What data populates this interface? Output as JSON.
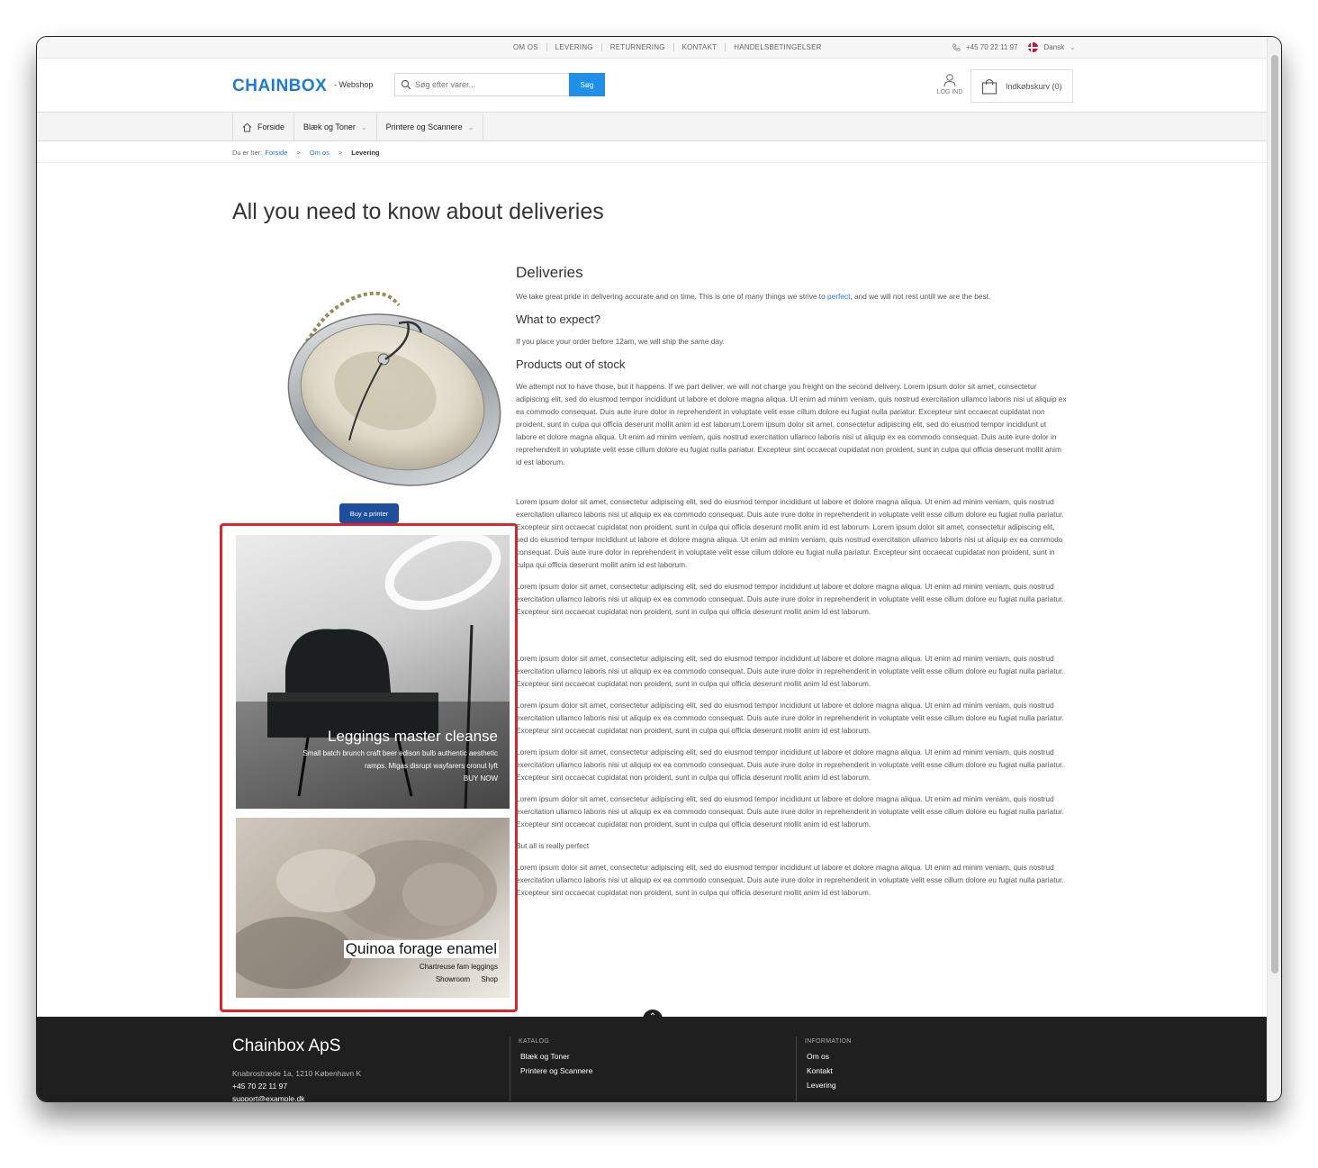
{
  "topbar": {
    "links": [
      "OM OS",
      "LEVERING",
      "RETURNERING",
      "KONTAKT",
      "HANDELSBETINGELSER"
    ],
    "phone": "+45 70 22 11 97",
    "language": "Dansk"
  },
  "header": {
    "logo": "CHAINBOX",
    "logo_sub": "- Webshop",
    "search_placeholder": "Søg efter varer...",
    "search_button": "Søg",
    "login_label": "LOG IND",
    "cart_label": "Indkøbskurv (0)"
  },
  "nav": {
    "items": [
      {
        "label": "Forside"
      },
      {
        "label": "Blæk og Toner"
      },
      {
        "label": "Printere og Scannere"
      }
    ]
  },
  "breadcrumb": {
    "prefix": "Du er her:",
    "items": [
      "Forside",
      "Om os",
      "Levering"
    ],
    "separator": ">"
  },
  "page": {
    "title": "All you need to know about deliveries",
    "buy_printer_button": "Buy a printer"
  },
  "promos": [
    {
      "title": "Leggings master cleanse",
      "subtitle_line1": "Small batch brunch craft beer edison bulb authentic aesthetic",
      "subtitle_line2": "ramps. Migas disrupt wayfarers cronut lyft",
      "cta": "BUY NOW"
    },
    {
      "title": "Quinoa forage enamel",
      "subtitle_line1": "Chartreuse fam leggings",
      "links": [
        "Showroom",
        "Shop"
      ]
    }
  ],
  "content": {
    "deliveries_heading": "Deliveries",
    "deliveries_text_pre": "We take great pride in delivering accurate and on time. This is one of many things we strive to",
    "deliveries_link": "perfect",
    "deliveries_text_post": ", and we will not rest untill we are the best.",
    "expect_heading": "What to expect?",
    "expect_text": "If you place your order before 12am, we will ship the same day.",
    "stock_heading": "Products out of stock",
    "stock_text": "We attempt not to have those, but it happens. If we part deliver, we will not charge you freight on the second delivery. Lorem ipsum dolor sit amet, consectetur adipiscing elit, sed do eiusmod tempor incididunt ut labore et dolore magna aliqua. Ut enim ad minim veniam, quis nostrud exercitation ullamco laboris nisi ut aliquip ex ea commodo consequat. Duis aute irure dolor in reprehenderit in voluptate velit esse cillum dolore eu fugiat nulla pariatur. Excepteur sint occaecat cupidatat non proident, sunt in culpa qui officia deserunt mollit anim id est laborum.Lorem ipsum dolor sit amet, consectetur adipiscing elit, sed do eiusmod tempor incididunt ut labore et dolore magna aliqua. Ut enim ad minim veniam, quis nostrud exercitation ullamco laboris nisi ut aliquip ex ea commodo consequat. Duis aute irure dolor in reprehenderit in voluptate velit esse cillum dolore eu fugiat nulla pariatur. Excepteur sint occaecat cupidatat non proident, sunt in culpa qui officia deserunt mollit anim id est laborum.",
    "para_long": "Lorem ipsum dolor sit amet, consectetur adipiscing elit, sed do eiusmod tempor incididunt ut labore et dolore magna aliqua. Ut enim ad minim veniam, quis nostrud exercitation ullamco laboris nisi ut aliquip ex ea commodo consequat. Duis aute irure dolor in reprehenderit in voluptate velit esse cillum dolore eu fugiat nulla pariatur. Excepteur sint occaecat cupidatat non proident, sunt in culpa qui officia deserunt mollit anim id est laborum. Lorem ipsum dolor sit amet, consectetur adipiscing elit, sed do eiusmod tempor incididunt ut labore et dolore magna aliqua. Ut enim ad minim veniam, quis nostrud exercitation ullamco laboris nisi ut aliquip ex ea commodo consequat. Duis aute irure dolor in reprehenderit in voluptate velit esse cillum dolore eu fugiat nulla pariatur. Excepteur sint occaecat cupidatat non proident, sunt in culpa qui officia deserunt mollit anim id est laborum.",
    "para_short": "Lorem ipsum dolor sit amet, consectetur adipiscing elit, sed do eiusmod tempor incididunt ut labore et dolore magna aliqua. Ut enim ad minim veniam, quis nostrud exercitation ullamco laboris nisi ut aliquip ex ea commodo consequat. Duis aute irure dolor in reprehenderit in voluptate velit esse cillum dolore eu fugiat nulla pariatur. Excepteur sint occaecat cupidatat non proident, sunt in culpa qui officia deserunt mollit anim id est laborum.",
    "perfect_line": "But all is really perfect"
  },
  "footer": {
    "company": "Chainbox ApS",
    "address": "Knabrostræde 1a, 1210 København K",
    "phone": "+45 70 22 11 97",
    "email": "support@example.dk",
    "catalog_heading": "KATALOG",
    "catalog_links": [
      "Blæk og Toner",
      "Printere og Scannere"
    ],
    "info_heading": "INFORMATION",
    "info_links": [
      "Om os",
      "Kontakt",
      "Levering"
    ]
  },
  "colors": {
    "brand": "#1f7ad3",
    "search_button": "#1f8fe8",
    "buy_button": "#1d4f9e",
    "highlight_border": "#d9262d",
    "footer_bg": "#1f1f1f"
  }
}
